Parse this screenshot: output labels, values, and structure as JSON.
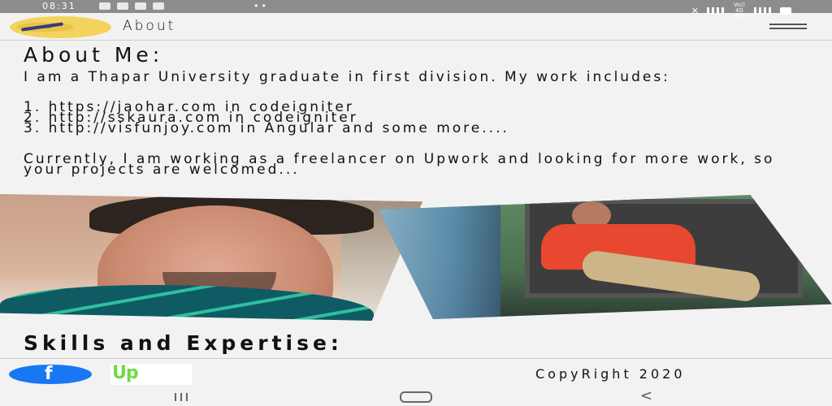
{
  "status_bar": {
    "time": "08:31",
    "left_dots": "••",
    "network_label": "Vo)) 4G LTE2"
  },
  "header": {
    "title": "About"
  },
  "about": {
    "heading": "About Me:",
    "intro": "I am a Thapar University graduate in first division. My work includes:",
    "works": [
      "1. https://jaohar.com in codeigniter",
      "2. http://sskaura.com in codeigniter",
      "3. http://visfunjoy.com in Angular and some more...."
    ],
    "current": "Currently, I am working as a freelancer on Upwork and looking for more work, so your projects are welcomed..."
  },
  "skills": {
    "heading": "Skills and Expertise:"
  },
  "footer": {
    "facebook_label": "f",
    "upwork_label": "Up",
    "copyright": "CopyRight 2020"
  },
  "nav": {
    "back_glyph": "<"
  }
}
